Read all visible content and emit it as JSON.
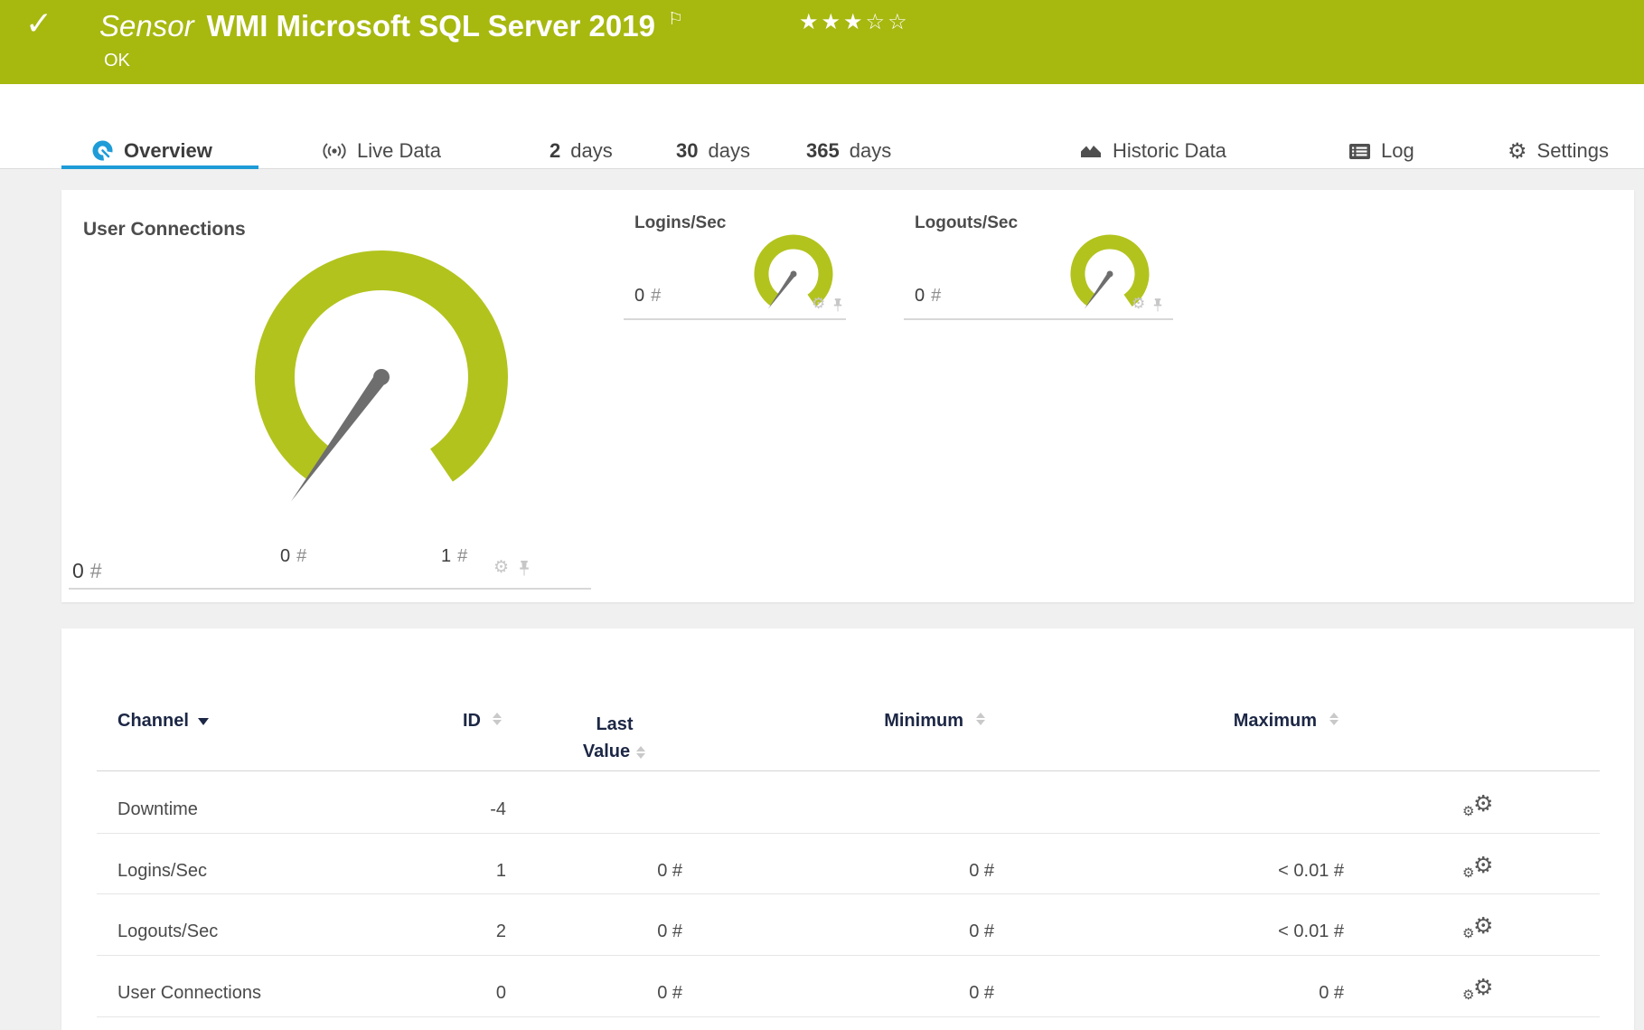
{
  "colors": {
    "header_green": "#a7b80f",
    "gauge_green": "#b2c31d",
    "accent_blue": "#1e9cd8",
    "table_header_navy": "#1c2745",
    "body_text": "#4a4a4a",
    "needle_gray": "#6e6e6e",
    "muted_icon_gray": "#c7c7c7",
    "page_background": "#f0f0f0"
  },
  "icons": {
    "check": "✓",
    "flag": "⚐",
    "gear": "⚙"
  },
  "header": {
    "type_label": "Sensor",
    "title": "WMI Microsoft SQL Server 2019",
    "status": "OK",
    "rating_stars": "★★★☆☆",
    "rating_filled": 3,
    "rating_total": 5
  },
  "tabs": {
    "overview": {
      "label": "Overview"
    },
    "live_data": {
      "label": "Live Data"
    },
    "days2": {
      "num": "2",
      "label": "days"
    },
    "days30": {
      "num": "30",
      "label": "days"
    },
    "days365": {
      "num": "365",
      "label": "days"
    },
    "historic": {
      "label": "Historic Data"
    },
    "log": {
      "label": "Log"
    },
    "settings": {
      "label": "Settings"
    }
  },
  "gauges": {
    "main": {
      "title": "User Connections",
      "value": "0",
      "unit": "#",
      "scale_min": "0",
      "scale_min_unit": "#",
      "scale_max": "1",
      "scale_max_unit": "#"
    },
    "logins": {
      "title": "Logins/Sec",
      "value": "0",
      "unit": "#"
    },
    "logouts": {
      "title": "Logouts/Sec",
      "value": "0",
      "unit": "#"
    }
  },
  "table": {
    "headers": {
      "channel": "Channel",
      "id": "ID",
      "last_line1": "Last",
      "last_line2": "Value",
      "minimum": "Minimum",
      "maximum": "Maximum"
    },
    "rows": [
      {
        "channel": "Downtime",
        "id": "-4",
        "last_value": "",
        "minimum": "",
        "maximum": ""
      },
      {
        "channel": "Logins/Sec",
        "id": "1",
        "last_value": "0 #",
        "minimum": "0 #",
        "maximum": "< 0.01 #"
      },
      {
        "channel": "Logouts/Sec",
        "id": "2",
        "last_value": "0 #",
        "minimum": "0 #",
        "maximum": "< 0.01 #"
      },
      {
        "channel": "User Connections",
        "id": "0",
        "last_value": "0 #",
        "minimum": "0 #",
        "maximum": "0 #"
      }
    ]
  }
}
